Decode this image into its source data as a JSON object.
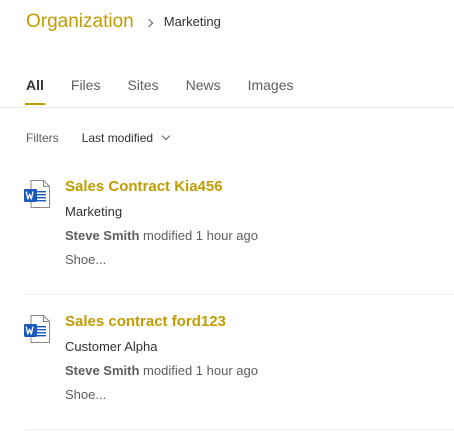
{
  "breadcrumb": {
    "root": "Organization",
    "current": "Marketing"
  },
  "tabs": [
    {
      "label": "All",
      "active": true
    },
    {
      "label": "Files",
      "active": false
    },
    {
      "label": "Sites",
      "active": false
    },
    {
      "label": "News",
      "active": false
    },
    {
      "label": "Images",
      "active": false
    }
  ],
  "filters": {
    "label": "Filters",
    "sort_label": "Last modified"
  },
  "results": [
    {
      "icon": "word-document-icon",
      "title": "Sales Contract Kia456",
      "site": "Marketing",
      "author": "Steve Smith",
      "modified_text": "modified 1 hour ago",
      "snippet": "Shoe..."
    },
    {
      "icon": "word-document-icon",
      "title": "Sales contract ford123",
      "site": "Customer Alpha",
      "author": "Steve Smith",
      "modified_text": "modified 1 hour ago",
      "snippet": "Shoe..."
    }
  ],
  "colors": {
    "accent": "#c19c00",
    "word_blue": "#185abd",
    "text_primary": "#323130",
    "text_secondary": "#605e5c",
    "divider": "#edebe9"
  }
}
